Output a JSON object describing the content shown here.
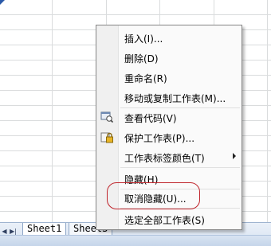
{
  "menu": {
    "items": [
      {
        "label": "插入(I)...",
        "icon": null,
        "submenu": false
      },
      {
        "label": "删除(D)",
        "icon": null,
        "submenu": false
      },
      {
        "label": "重命名(R)",
        "icon": null,
        "submenu": false
      },
      {
        "label": "移动或复制工作表(M)...",
        "icon": null,
        "submenu": false
      },
      {
        "label": "查看代码(V)",
        "icon": "view-code-icon",
        "submenu": false
      },
      {
        "label": "保护工作表(P)...",
        "icon": "protect-sheet-icon",
        "submenu": false
      },
      {
        "label": "工作表标签颜色(T)",
        "icon": null,
        "submenu": true
      },
      {
        "label": "隐藏(H)",
        "icon": null,
        "submenu": false
      },
      {
        "label": "取消隐藏(U)...",
        "icon": null,
        "submenu": false,
        "highlighted": true
      },
      {
        "label": "选定全部工作表(S)",
        "icon": null,
        "submenu": false
      }
    ]
  },
  "sheet_tabs": [
    {
      "label": "Sheet1"
    },
    {
      "label": "Sheet3"
    }
  ],
  "colors": {
    "highlight_ring": "#c0262d",
    "grid_line": "#dadcdd",
    "menu_border": "#868686"
  }
}
